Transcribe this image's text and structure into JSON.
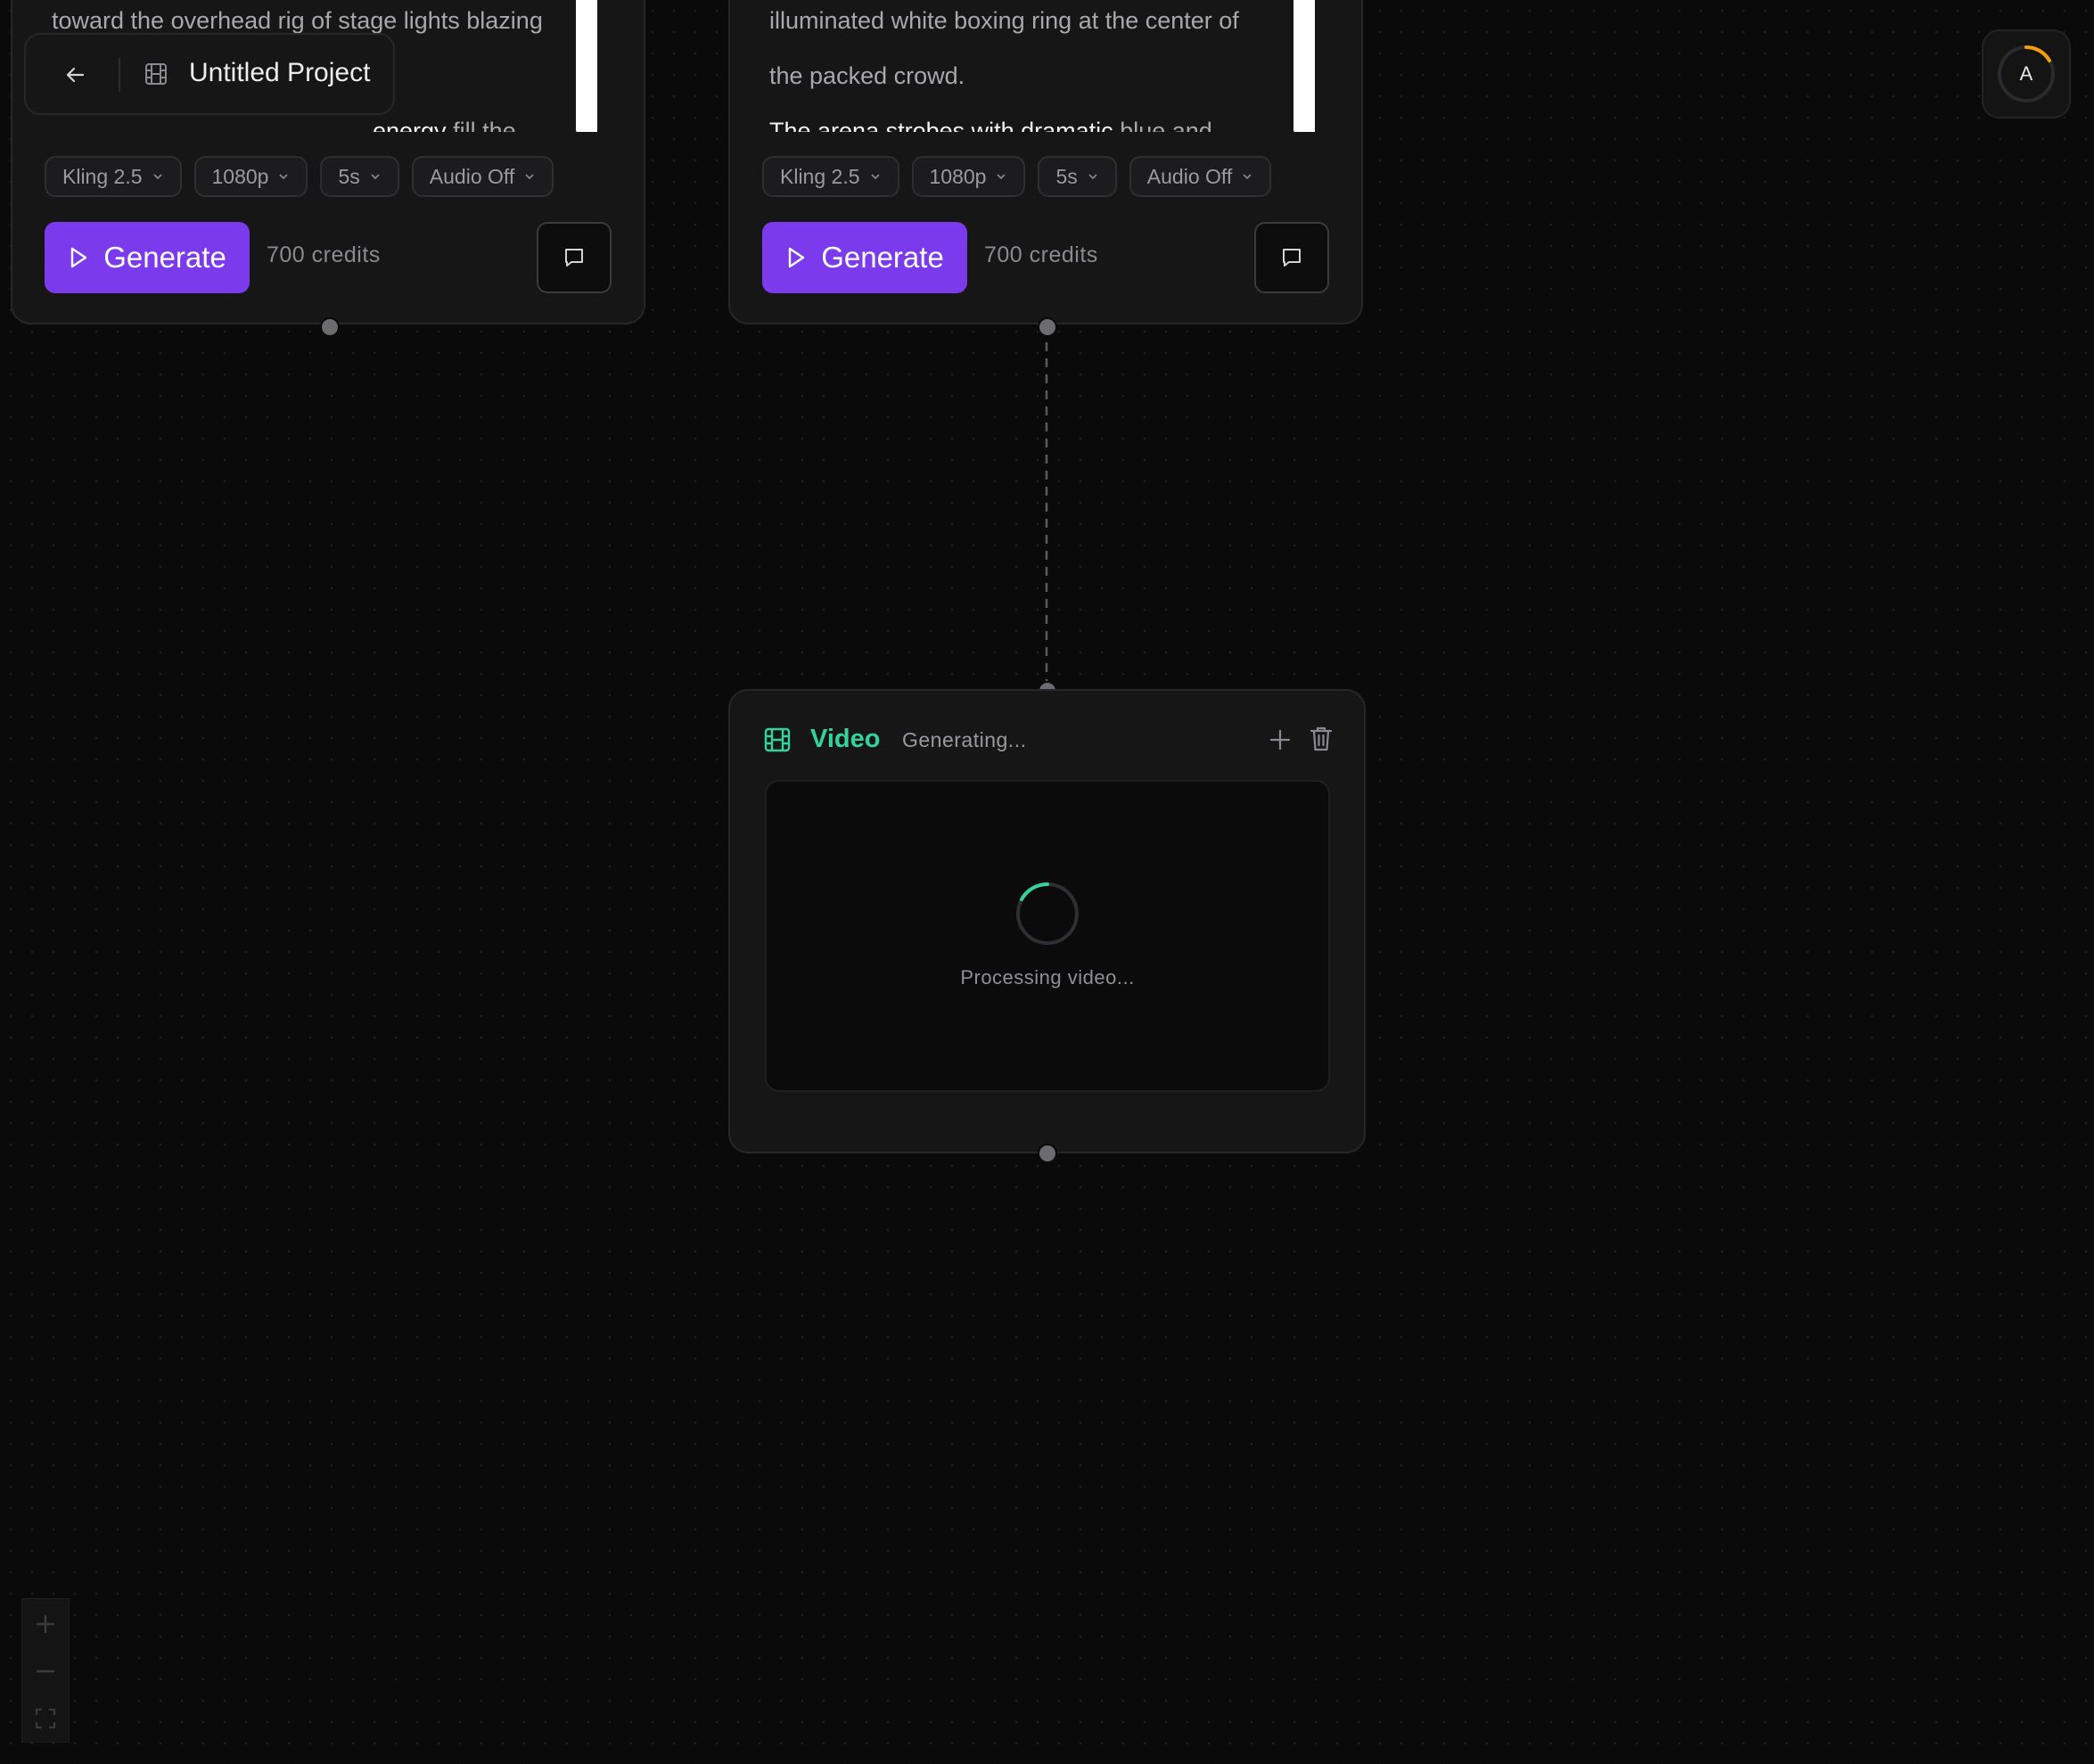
{
  "project": {
    "title": "Untitled Project"
  },
  "avatar": {
    "initial": "A",
    "ring_color": "#f59e0b"
  },
  "cards": [
    {
      "prompt_lines": [
        {
          "segments": [
            {
              "text": "toward the overhead rig of stage lights blazing",
              "em": false
            }
          ]
        },
        {
          "segments": [
            {
              "text": "",
              "em": false
            }
          ]
        },
        {
          "segments": [
            {
              "text": "energy",
              "em": true
            },
            {
              "text": " fill the",
              "em": false
            }
          ]
        }
      ],
      "chips": [
        "Kling 2.5",
        "1080p",
        "5s",
        "Audio Off"
      ],
      "generate_label": "Generate",
      "credits": "700 credits"
    },
    {
      "prompt_lines": [
        {
          "segments": [
            {
              "text": "illuminated white boxing ring at the center of",
              "em": false
            }
          ]
        },
        {
          "segments": [
            {
              "text": "the packed crowd.",
              "em": false
            }
          ]
        },
        {
          "segments": [
            {
              "text": "The arena strobes with dramatic",
              "em": true
            },
            {
              "text": " blue and",
              "em": false
            }
          ]
        }
      ],
      "chips": [
        "Kling 2.5",
        "1080p",
        "5s",
        "Audio Off"
      ],
      "generate_label": "Generate",
      "credits": "700 credits"
    }
  ],
  "video_node": {
    "title": "Video",
    "status": "Generating...",
    "processing_text": "Processing video...",
    "accent": "#34d399"
  },
  "colors": {
    "primary": "#7c3aed",
    "background": "#0a0a0a",
    "card": "#161617"
  }
}
